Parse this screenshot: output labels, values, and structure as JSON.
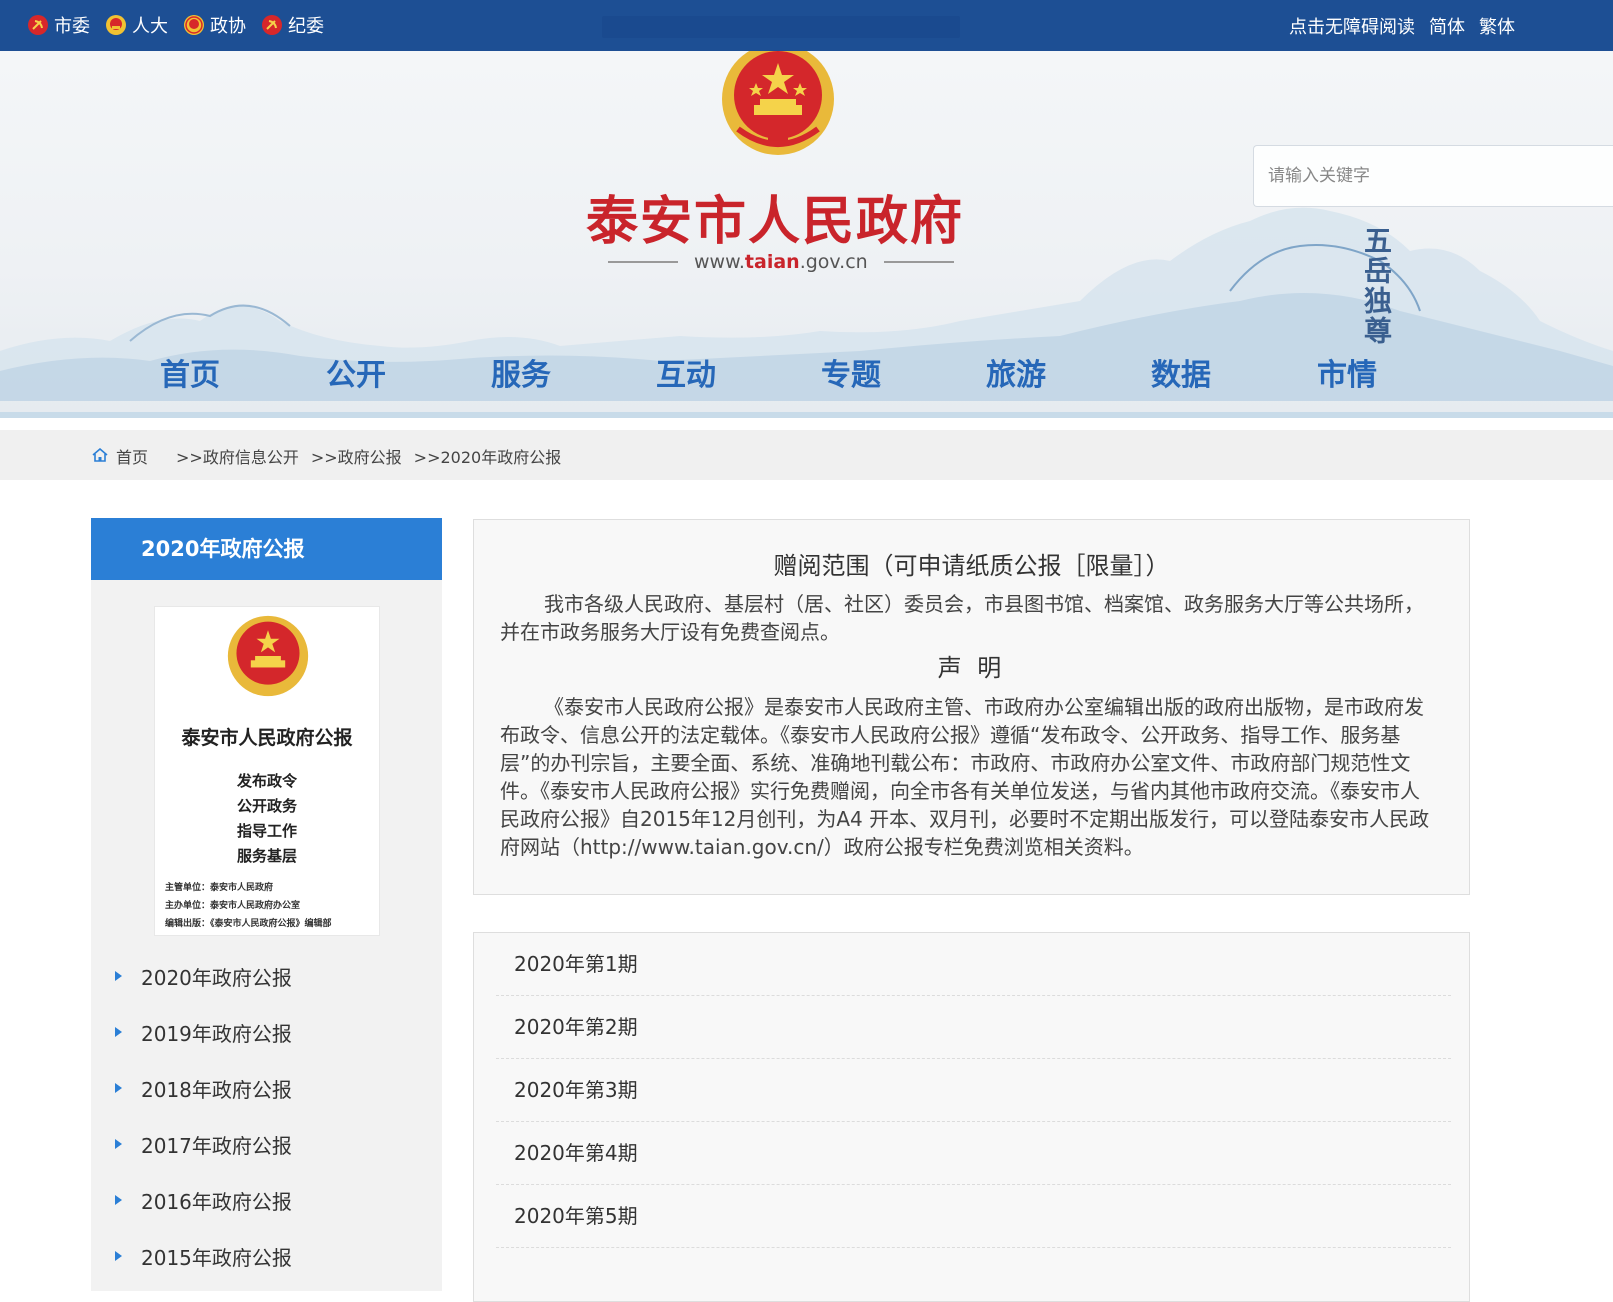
{
  "topbar": {
    "links": [
      {
        "label": "市委",
        "icon": "party-emblem-icon"
      },
      {
        "label": "人大",
        "icon": "national-emblem-icon"
      },
      {
        "label": "政协",
        "icon": "cppcc-emblem-icon"
      },
      {
        "label": "纪委",
        "icon": "party-emblem-icon"
      }
    ],
    "accessibility_label": "点击无障碍阅读",
    "simplified_label": "简体",
    "traditional_label": "繁体"
  },
  "header": {
    "site_title": "泰安市人民政府",
    "site_url_prefix": "www.",
    "site_url_domain": "taian",
    "site_url_suffix": ".gov.cn",
    "calligraphy": "五岳独尊",
    "search_placeholder": "请输入关键字"
  },
  "nav": {
    "items": [
      {
        "label": "首页"
      },
      {
        "label": "公开"
      },
      {
        "label": "服务"
      },
      {
        "label": "互动"
      },
      {
        "label": "专题"
      },
      {
        "label": "旅游"
      },
      {
        "label": "数据"
      },
      {
        "label": "市情"
      }
    ]
  },
  "breadcrumb": {
    "home": "首页",
    "items": [
      ">>政府信息公开",
      ">>政府公报",
      ">>2020年政府公报"
    ]
  },
  "sidebar": {
    "title": "2020年政府公报",
    "cover": {
      "title": "泰安市人民政府公报",
      "slogans": [
        "发布政令",
        "公开政务",
        "指导工作",
        "服务基层"
      ],
      "meta": [
        "主管单位：泰安市人民政府",
        "主办单位：泰安市人民政府办公室",
        "编辑出版：《泰安市人民政府公报》编辑部"
      ]
    },
    "items": [
      {
        "label": "2020年政府公报"
      },
      {
        "label": "2019年政府公报"
      },
      {
        "label": "2018年政府公报"
      },
      {
        "label": "2017年政府公报"
      },
      {
        "label": "2016年政府公报"
      },
      {
        "label": "2015年政府公报"
      }
    ]
  },
  "notice": {
    "heading1": "赠阅范围（可申请纸质公报［限量］）",
    "para1": "我市各级人民政府、基层村（居、社区）委员会，市县图书馆、档案馆、政务服务大厅等公共场所，并在市政务服务大厅设有免费查阅点。",
    "heading2": "声 明",
    "para2": "《泰安市人民政府公报》是泰安市人民政府主管、市政府办公室编辑出版的政府出版物，是市政府发布政令、信息公开的法定载体。《泰安市人民政府公报》遵循“发布政令、公开政务、指导工作、服务基层”的办刊宗旨，主要全面、系统、准确地刊载公布：市政府、市政府办公室文件、市政府部门规范性文件。《泰安市人民政府公报》实行免费赠阅，向全市各有关单位发送，与省内其他市政府交流。《泰安市人民政府公报》自2015年12月创刊，为A4 开本、双月刊，必要时不定期出版发行，可以登陆泰安市人民政府网站（http://www.taian.gov.cn/）政府公报专栏免费浏览相关资料。"
  },
  "issues": [
    {
      "label": "2020年第1期"
    },
    {
      "label": "2020年第2期"
    },
    {
      "label": "2020年第3期"
    },
    {
      "label": "2020年第4期"
    },
    {
      "label": "2020年第5期"
    }
  ],
  "colors": {
    "topbar_bg": "#1d4f94",
    "brand_red": "#c9242b",
    "nav_blue": "#2667b8",
    "sidebar_accent": "#2b7fd6"
  }
}
